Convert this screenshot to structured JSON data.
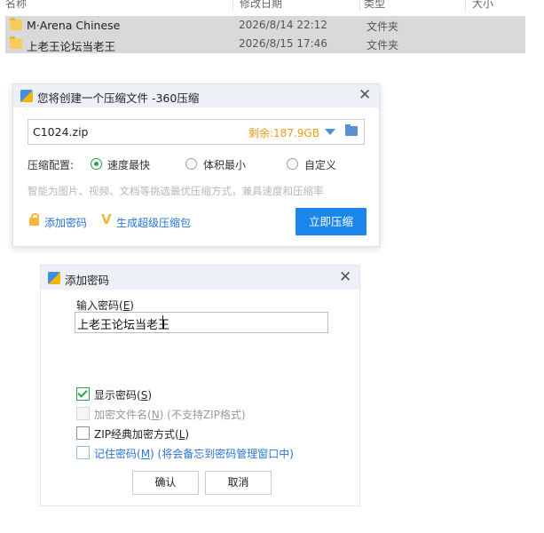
{
  "explorer": {
    "columns": [
      "名称",
      "修改日期",
      "类型",
      "大小"
    ],
    "rows": [
      {
        "name": "M·Arena Chinese",
        "date": "2026/8/14 22:12",
        "type": "文件夹"
      },
      {
        "name": "上老王论坛当老王",
        "date": "2026/8/15 17:46",
        "type": "文件夹"
      }
    ],
    "folder_color": "#f6cd5a",
    "selected_row_color": "#d9d9d9"
  },
  "compress_dialog": {
    "title": "您将创建一个压缩文件 -360压缩",
    "filename": "C1024.zip",
    "free_space": "剩余:187.9GB",
    "config_label": "压缩配置:",
    "options": [
      "速度最快",
      "体积最小",
      "自定义"
    ],
    "selected_option": "速度最快",
    "hint": "智能为图片、视频、文档等挑选最优压缩方式，兼具速度和压缩率",
    "add_password": "添加密码",
    "super_pack": "生成超级压缩包",
    "compress_button": "立即压缩",
    "accent_color": "#1b86ec"
  },
  "password_dialog": {
    "title": "添加密码",
    "input_label": "输入密码(",
    "input_label_key": "E",
    "input_label_end": ")",
    "password_value": "上老王论坛当老王",
    "options": [
      {
        "pre": "显示密码(",
        "key": "S",
        "post": ")",
        "extra": "",
        "checked": true
      },
      {
        "pre": "加密文件名(",
        "key": "N",
        "post": ")",
        "extra": " (不支持ZIP格式)",
        "checked": false
      },
      {
        "pre": "ZIP经典加密方式(",
        "key": "L",
        "post": ")",
        "extra": "",
        "checked": false
      },
      {
        "pre": "记住密码(",
        "key": "M",
        "post": ")",
        "extra": " (将会备忘到密码管理窗口中)",
        "checked": false
      }
    ],
    "ok_label": "确认",
    "cancel_label": "取消"
  }
}
